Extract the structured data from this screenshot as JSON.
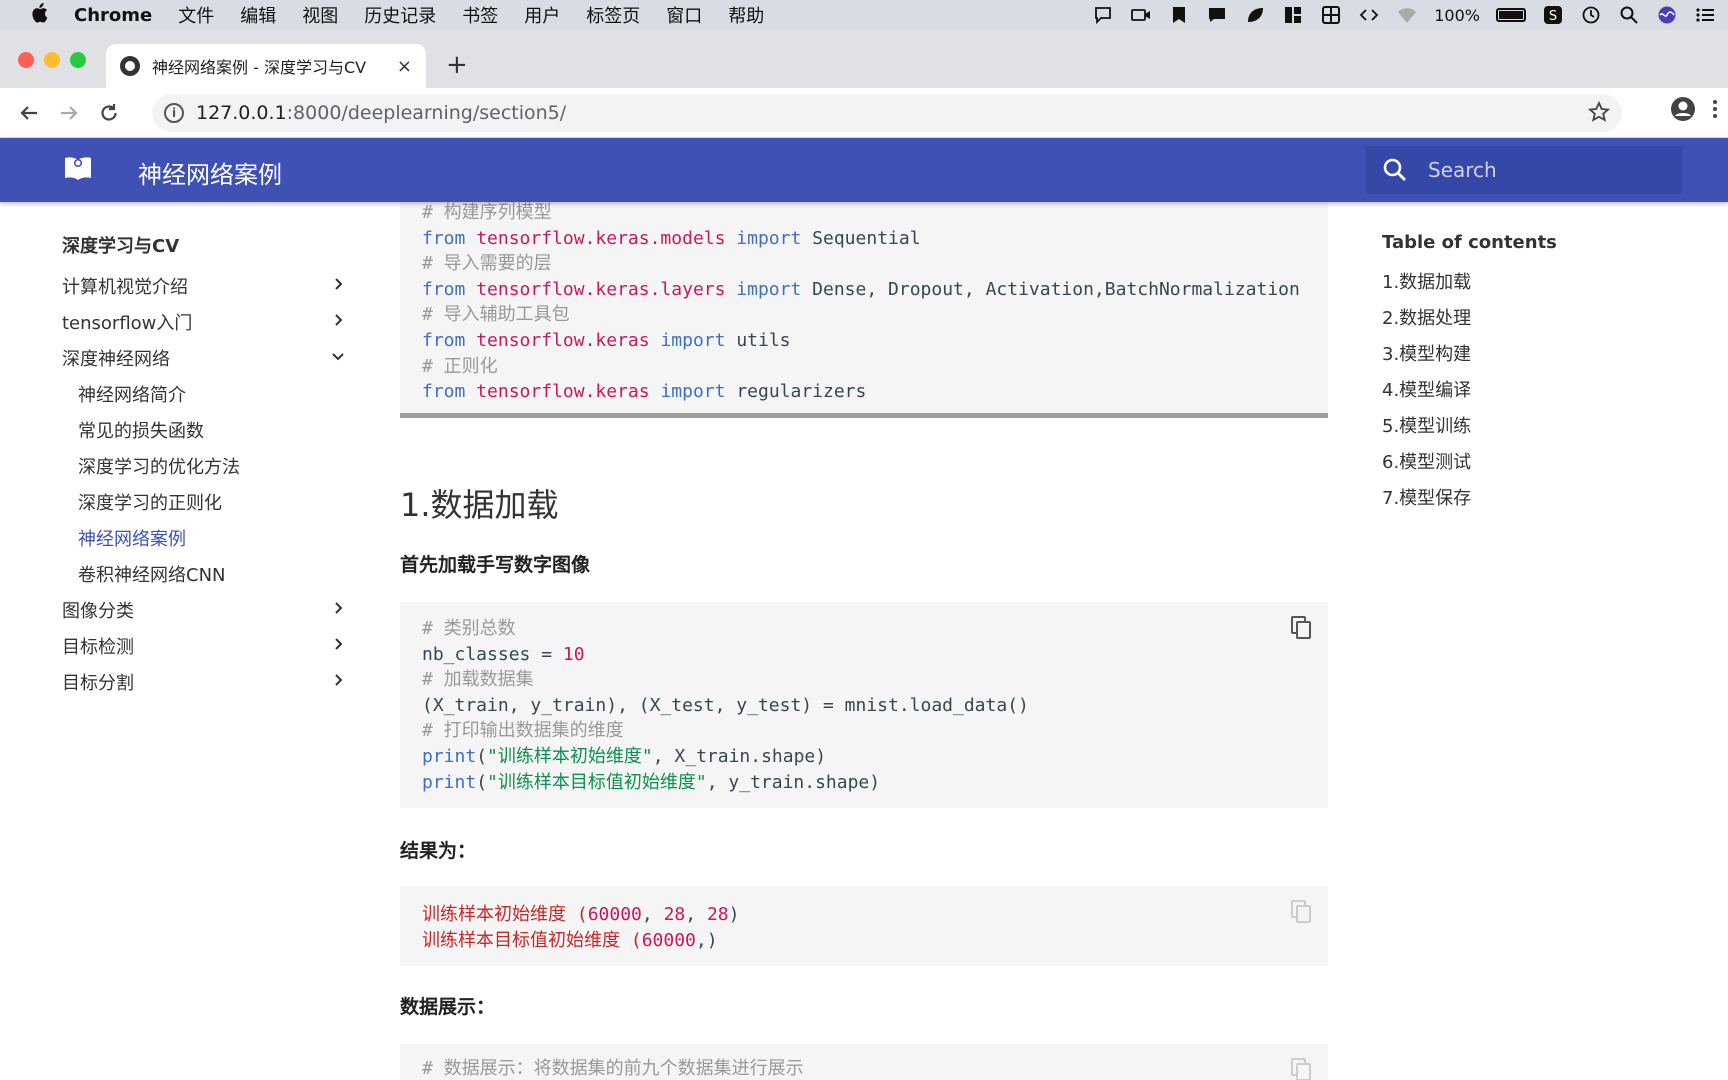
{
  "menubar": {
    "app": "Chrome",
    "items": [
      "文件",
      "编辑",
      "视图",
      "历史记录",
      "书签",
      "用户",
      "标签页",
      "窗口",
      "帮助"
    ],
    "battery": "100%"
  },
  "tab": {
    "title": "神经网络案例 - 深度学习与CV",
    "close": "×",
    "new_tab": "+"
  },
  "address": {
    "url_host": "127.0.0.1",
    "url_rest": ":8000/deeplearning/section5/"
  },
  "header": {
    "site_title": "神经网络案例",
    "search_placeholder": "Search"
  },
  "leftnav": {
    "title": "深度学习与CV",
    "items": [
      {
        "label": "计算机视觉介绍",
        "chevron": "right"
      },
      {
        "label": "tensorflow入门",
        "chevron": "right"
      },
      {
        "label": "深度神经网络",
        "chevron": "down"
      },
      {
        "label": "神经网络简介"
      },
      {
        "label": "常见的损失函数"
      },
      {
        "label": "深度学习的优化方法"
      },
      {
        "label": "深度学习的正则化"
      },
      {
        "label": "神经网络案例",
        "active": true
      },
      {
        "label": "卷积神经网络CNN"
      },
      {
        "label": "图像分类",
        "chevron": "right"
      },
      {
        "label": "目标检测",
        "chevron": "right"
      },
      {
        "label": "目标分割",
        "chevron": "right"
      }
    ]
  },
  "toc": {
    "title": "Table of contents",
    "items": [
      "1.数据加载",
      "2.数据处理",
      "3.模型构建",
      "4.模型编译",
      "5.模型训练",
      "6.模型测试",
      "7.模型保存"
    ]
  },
  "content": {
    "code1": {
      "c1": "# 构建序列模型",
      "l1": [
        "from",
        "tensorflow.keras.models",
        "import",
        "Sequential"
      ],
      "c2": "# 导入需要的层",
      "l2": [
        "from",
        "tensorflow.keras.layers",
        "import",
        "Dense, Dropout, Activation,BatchNormalization"
      ],
      "c3": "# 导入辅助工具包",
      "l3": [
        "from",
        "tensorflow.keras",
        "import",
        "utils"
      ],
      "c4": "# 正则化",
      "l4": [
        "from",
        "tensorflow.keras",
        "import",
        "regularizers"
      ]
    },
    "heading": "1.数据加载",
    "intro": "首先加载手写数字图像",
    "code2": {
      "c1": "# 类别总数",
      "l1a": "nb_classes = ",
      "l1b": "10",
      "c2": "# 加载数据集",
      "l2": "(X_train, y_train), (X_test, y_test) = mnist.load_data()",
      "c3": "# 打印输出数据集的维度",
      "l3": [
        "print",
        "(",
        "\"训练样本初始维度\"",
        ", X_train.shape)"
      ],
      "l4": [
        "print",
        "(",
        "\"训练样本目标值初始维度\"",
        ", y_train.shape)"
      ]
    },
    "result_label": "结果为：",
    "output": {
      "o1a": "训练样本初始维度 (",
      "o1b": "60000",
      "o1c": ", ",
      "o1d": "28",
      "o1e": ", ",
      "o1f": "28",
      "o1g": ")",
      "o2a": "训练样本目标值初始维度 (",
      "o2b": "60000",
      "o2c": ",)"
    },
    "display_label": "数据展示：",
    "code3": {
      "c1": "# 数据展示：将数据集的前九个数据集进行展示"
    }
  }
}
